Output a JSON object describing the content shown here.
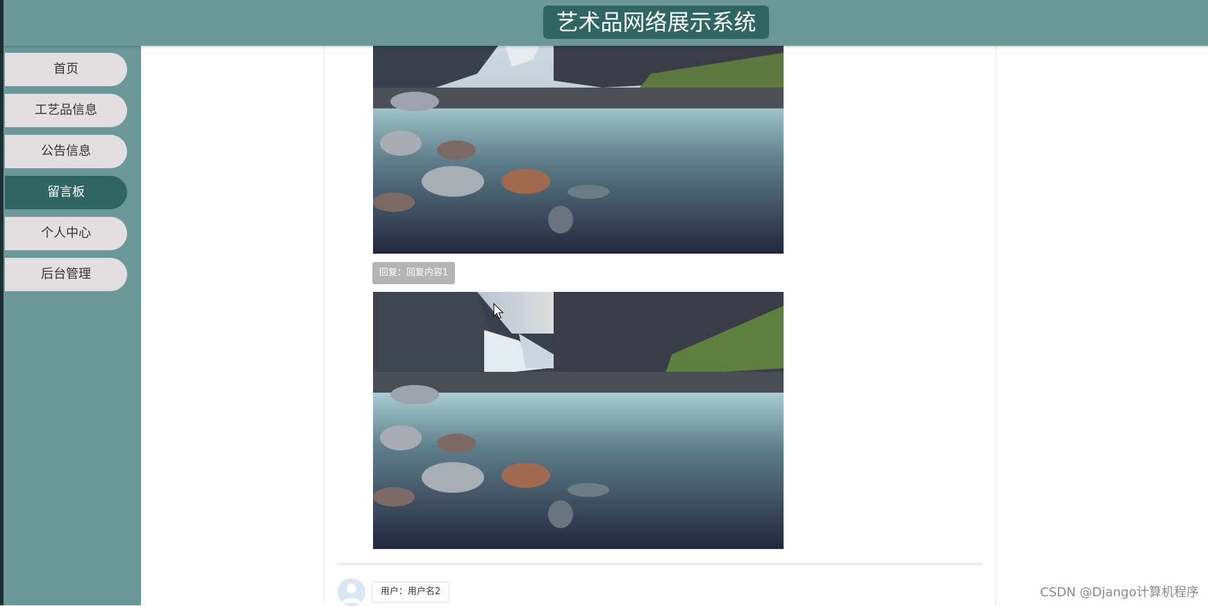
{
  "header": {
    "title": "艺术品网络展示系统"
  },
  "sidebar": {
    "items": [
      {
        "label": "首页",
        "active": false
      },
      {
        "label": "工艺品信息",
        "active": false
      },
      {
        "label": "公告信息",
        "active": false
      },
      {
        "label": "留言板",
        "active": true
      },
      {
        "label": "个人中心",
        "active": false
      },
      {
        "label": "后台管理",
        "active": false
      }
    ]
  },
  "message": {
    "reply_text": "回复：回复内容1",
    "next_user_text": "用户：用户名2"
  },
  "watermark": "CSDN @Django计算机程序",
  "colors": {
    "header_bg": "#6a9898",
    "accent_dark": "#2f6562",
    "nav_bg": "#e3dfe0"
  }
}
